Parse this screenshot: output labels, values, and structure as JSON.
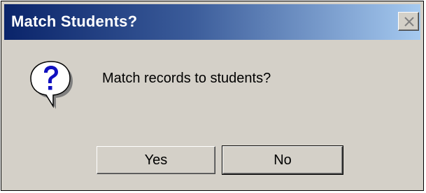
{
  "dialog": {
    "title": "Match Students?",
    "message": "Match records to students?",
    "icon": "question-icon",
    "close_icon": "close-x-icon",
    "buttons": {
      "yes_label": "Yes",
      "no_label": "No"
    }
  },
  "colors": {
    "titlebar_start": "#0a246a",
    "titlebar_end": "#a6caf0",
    "dialog_bg": "#d4d0c8",
    "icon_blue": "#1010c0"
  }
}
